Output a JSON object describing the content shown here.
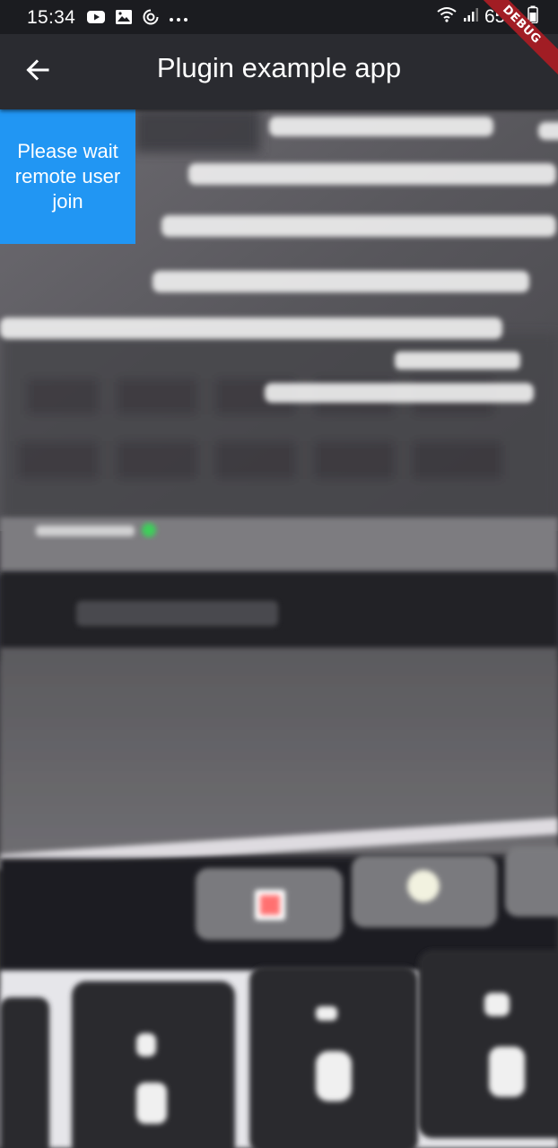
{
  "status_bar": {
    "time": "15:34",
    "battery": "65%",
    "left_icons": [
      "youtube-icon",
      "gallery-icon",
      "sync-icon",
      "more-icon"
    ],
    "right_icons": [
      "wifi-icon",
      "signal-icon",
      "battery-icon"
    ]
  },
  "app_bar": {
    "title": "Plugin example app",
    "back_icon": "arrow-left-icon"
  },
  "debug_banner": {
    "label": "DEBUG",
    "color": "#a11d24"
  },
  "wait_overlay": {
    "message": "Please wait remote user join",
    "color": "#2196f3"
  },
  "colors": {
    "status_bar": "#1b1c20",
    "app_bar": "#2a2b30",
    "accent": "#2196f3"
  }
}
